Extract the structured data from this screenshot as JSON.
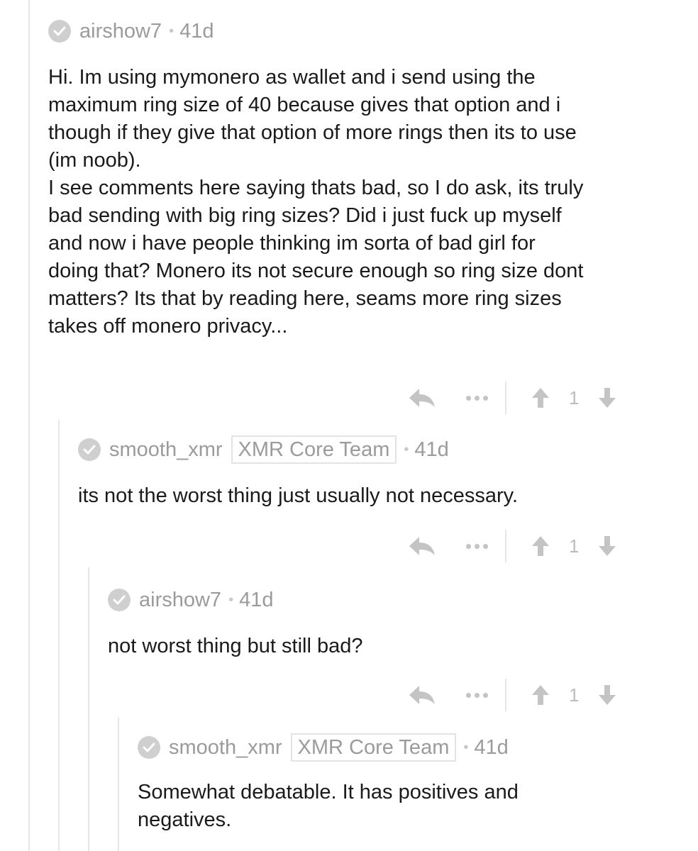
{
  "comments": [
    {
      "username": "airshow7",
      "age": "41d",
      "separator": "•",
      "body": "Hi. Im using mymonero as wallet and i send using the\nmaximum ring size of 40 because gives that option and i\nthough if they give that option of more rings then its to use\n(im noob).\nI see comments here saying thats bad, so I do ask, its truly\nbad sending with big ring sizes? Did i just fuck up myself\nand now i have people thinking im sorta of bad girl for\ndoing that? Monero its not secure enough so ring size dont\nmatters? Its that by reading here, seams more ring sizes\ntakes off monero privacy...",
      "score": "1"
    },
    {
      "username": "smooth_xmr",
      "flair": "XMR Core Team",
      "age": "41d",
      "separator": "•",
      "body": "its not the worst thing just usually not necessary.",
      "score": "1"
    },
    {
      "username": "airshow7",
      "age": "41d",
      "separator": "•",
      "body": "not worst thing but still bad?",
      "score": "1"
    },
    {
      "username": "smooth_xmr",
      "flair": "XMR Core Team",
      "age": "41d",
      "separator": "•",
      "body": "Somewhat debatable. It has positives and\nnegatives."
    }
  ],
  "icons": {
    "verified": "check-circle-icon",
    "reply": "reply-arrow-icon",
    "more": "more-dots-icon",
    "upvote": "upvote-arrow-icon",
    "downvote": "downvote-arrow-icon"
  },
  "colors": {
    "meta_text": "#9b9b9b",
    "body_text": "#1a1a1a",
    "action_icon": "#bdbdbd",
    "thread_line": "#e6e6e6"
  }
}
